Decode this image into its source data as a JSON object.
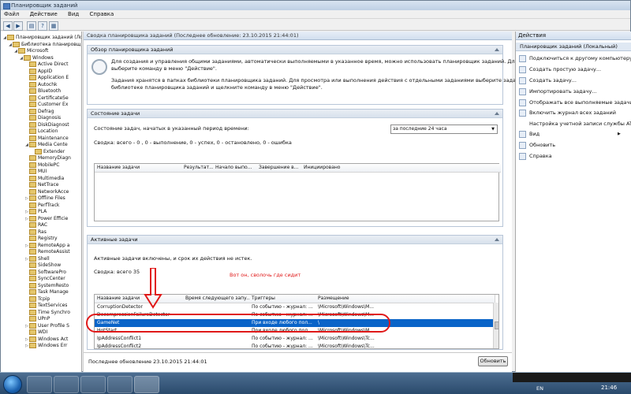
{
  "window": {
    "title": "Планировщик заданий"
  },
  "menubar": {
    "items": [
      "Файл",
      "Действие",
      "Вид",
      "Справка"
    ]
  },
  "tree": {
    "items": [
      {
        "label": "Планировщик заданий (Локальный)",
        "indent": 0
      },
      {
        "label": "Библиотека планировщика",
        "indent": 1
      },
      {
        "label": "Microsoft",
        "indent": 2
      },
      {
        "label": "Windows",
        "indent": 3
      },
      {
        "label": "Active Direct",
        "indent": 4
      },
      {
        "label": "AppID",
        "indent": 4
      },
      {
        "label": "Application E",
        "indent": 4
      },
      {
        "label": "Autochk",
        "indent": 4
      },
      {
        "label": "Bluetooth",
        "indent": 4
      },
      {
        "label": "CertificateSe",
        "indent": 4
      },
      {
        "label": "Customer Ex",
        "indent": 4
      },
      {
        "label": "Defrag",
        "indent": 4
      },
      {
        "label": "Diagnosis",
        "indent": 4
      },
      {
        "label": "DiskDiagnost",
        "indent": 4
      },
      {
        "label": "Location",
        "indent": 4
      },
      {
        "label": "Maintenance",
        "indent": 4
      },
      {
        "label": "Media Cente",
        "indent": 4
      },
      {
        "label": "Extender",
        "indent": 5
      },
      {
        "label": "MemoryDiagn",
        "indent": 4
      },
      {
        "label": "MobilePC",
        "indent": 4
      },
      {
        "label": "MUI",
        "indent": 4
      },
      {
        "label": "Multimedia",
        "indent": 4
      },
      {
        "label": "NetTrace",
        "indent": 4
      },
      {
        "label": "NetworkAcce",
        "indent": 4
      },
      {
        "label": "Offline Files",
        "indent": 4
      },
      {
        "label": "PerfTrack",
        "indent": 4
      },
      {
        "label": "PLA",
        "indent": 4
      },
      {
        "label": "Power Efficie",
        "indent": 4
      },
      {
        "label": "RAC",
        "indent": 4
      },
      {
        "label": "Ras",
        "indent": 4
      },
      {
        "label": "Registry",
        "indent": 4
      },
      {
        "label": "RemoteApp a",
        "indent": 4
      },
      {
        "label": "RemoteAssist",
        "indent": 4
      },
      {
        "label": "Shell",
        "indent": 4
      },
      {
        "label": "SideShow",
        "indent": 4
      },
      {
        "label": "SoftwarePro",
        "indent": 4
      },
      {
        "label": "SyncCenter",
        "indent": 4
      },
      {
        "label": "SystemResto",
        "indent": 4
      },
      {
        "label": "Task Manage",
        "indent": 4
      },
      {
        "label": "Tcpip",
        "indent": 4
      },
      {
        "label": "TextServices",
        "indent": 4
      },
      {
        "label": "Time Synchro",
        "indent": 4
      },
      {
        "label": "UPnP",
        "indent": 4
      },
      {
        "label": "User Profile S",
        "indent": 4
      },
      {
        "label": "WDI",
        "indent": 4
      },
      {
        "label": "Windows Act",
        "indent": 4
      },
      {
        "label": "Windows Err",
        "indent": 4
      }
    ]
  },
  "center": {
    "header": "Сводка планировщика заданий (Последнее обновление: 23.10.2015 21:44:01)",
    "overview": {
      "title": "Обзор планировщика заданий",
      "line1": "Для создания и управления общими заданиями, автоматически выполняемыми в указанное время, можно использовать планировщик заданий. Для начала",
      "line2": "выберите команду в меню \"Действие\".",
      "line3": "Задания хранятся в папках библиотеки планировщика заданий. Для просмотра или выполнения действия с отдельными заданиями выберите задание в",
      "line4": "библиотеке планировщика заданий и щелкните команду в меню \"Действие\"."
    },
    "status": {
      "title": "Состояние задачи",
      "period_label": "Состояние задач, начатых в указанный период времени:",
      "period_value": "за последние 24 часа",
      "summary": "Сводка: всего - 0 , 0 - выполнение, 0 - успех, 0 - остановлено, 0 - ошибка",
      "columns": [
        "Название задачи",
        "Результат...",
        "Начало выпо...",
        "Завершение в...",
        "Инициировано"
      ]
    },
    "active": {
      "title": "Активные задачи",
      "desc": "Активные задачи включены, и срок их действия не истек.",
      "summary": "Сводка: всего 35",
      "columns": [
        "Название задачи",
        "Время следующего запу...",
        "Триггеры",
        "Размещение"
      ],
      "rows": [
        {
          "name": "CorruptionDetector",
          "next": "",
          "trigger": "По событию - журнал: ...",
          "location": "\\Microsoft\\Windows\\M..."
        },
        {
          "name": "DecompressionFailureDetector",
          "next": "",
          "trigger": "По событию - журнал: ...",
          "location": "\\Microsoft\\Windows\\M..."
        },
        {
          "name": "GameNet",
          "next": "",
          "trigger": "При входе любого пол...",
          "location": "\\"
        },
        {
          "name": "HotStart",
          "next": "",
          "trigger": "При входе любого пол...",
          "location": "\\Microsoft\\Windows\\M..."
        },
        {
          "name": "IpAddressConflict1",
          "next": "",
          "trigger": "По событию - журнал: ...",
          "location": "\\Microsoft\\Windows\\Tc..."
        },
        {
          "name": "IpAddressConflict2",
          "next": "",
          "trigger": "По событию - журнал: ...",
          "location": "\\Microsoft\\Windows\\Tc..."
        }
      ],
      "last_update": "Последнее обновление 23.10.2015 21:44:01",
      "refresh_button": "Обновить"
    },
    "annotation": "Вот он, сволочь где сидит"
  },
  "actions": {
    "header": "Действия",
    "subheader": "Планировщик заданий (Локальный)",
    "items": [
      "Подключиться к другому компьютеру...",
      "Создать простую задачу...",
      "Создать задачу...",
      "Импортировать задачу...",
      "Отображать все выполняемые задачи",
      "Включить журнал всех заданий",
      "Настройка учетной записи службы AT",
      "Вид",
      "Обновить",
      "Справка"
    ]
  },
  "taskbar": {
    "lang": "EN",
    "time": "21:46"
  },
  "colors": {
    "selection": "#0a64c8",
    "annotation_red": "#e01919"
  }
}
